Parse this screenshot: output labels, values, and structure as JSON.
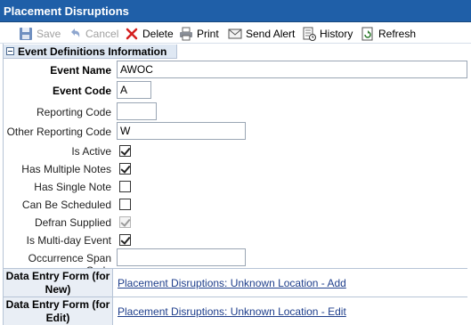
{
  "window": {
    "title": "Placement Disruptions"
  },
  "toolbar": {
    "save_label": "Save",
    "cancel_label": "Cancel",
    "delete_label": "Delete",
    "print_label": "Print",
    "send_alert_label": "Send Alert",
    "history_label": "History",
    "refresh_label": "Refresh"
  },
  "section": {
    "title": "Event Definitions Information"
  },
  "fields": {
    "event_name": {
      "label": "Event Name",
      "value": "AWOC"
    },
    "event_code": {
      "label": "Event Code",
      "value": "A"
    },
    "reporting_code": {
      "label": "Reporting Code",
      "value": ""
    },
    "other_reporting_code": {
      "label": "Other Reporting Code",
      "value": "W"
    },
    "is_active": {
      "label": "Is Active",
      "checked": true
    },
    "has_multiple_notes": {
      "label": "Has Multiple Notes",
      "checked": true
    },
    "has_single_note": {
      "label": "Has Single Note",
      "checked": false
    },
    "can_be_scheduled": {
      "label": "Can Be Scheduled",
      "checked": false
    },
    "defran_supplied": {
      "label": "Defran Supplied",
      "checked": true,
      "disabled": true
    },
    "is_multi_day_event": {
      "label": "Is Multi-day Event",
      "checked": true
    },
    "occurrence_span_code": {
      "label": "Occurrence Span Code",
      "value": ""
    }
  },
  "data_entry": {
    "new": {
      "label": "Data Entry Form (for New)",
      "link": "Placement Disruptions: Unknown Location - Add"
    },
    "edit": {
      "label": "Data Entry Form (for Edit)",
      "link": "Placement Disruptions: Unknown Location - Edit"
    }
  }
}
